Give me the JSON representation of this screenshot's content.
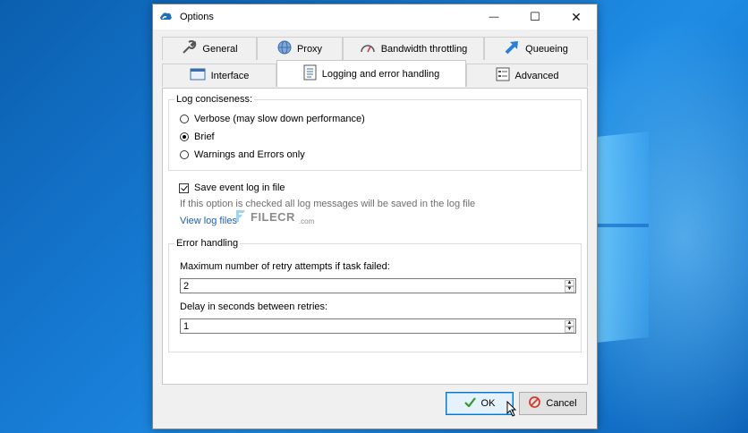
{
  "window": {
    "title": "Options"
  },
  "titlebar": {
    "minimize": "—",
    "maximize": "☐",
    "close": "✕"
  },
  "tabs": {
    "row1": [
      {
        "label": "General",
        "icon": "wrench-icon"
      },
      {
        "label": "Proxy",
        "icon": "globe-icon"
      },
      {
        "label": "Bandwidth throttling",
        "icon": "gauge-icon"
      },
      {
        "label": "Queueing",
        "icon": "arrow-up-right-icon"
      }
    ],
    "row2": [
      {
        "label": "Interface",
        "icon": "window-icon"
      },
      {
        "label": "Logging and error handling",
        "icon": "document-icon",
        "active": true
      },
      {
        "label": "Advanced",
        "icon": "list-settings-icon"
      }
    ]
  },
  "log_conciseness": {
    "legend": "Log conciseness:",
    "options": [
      {
        "label": "Verbose (may slow down performance)",
        "selected": false
      },
      {
        "label": "Brief",
        "selected": true
      },
      {
        "label": "Warnings and Errors only",
        "selected": false
      }
    ]
  },
  "event_log": {
    "checkbox_label": "Save event log in file",
    "checked": true,
    "hint": "If this option is checked all log messages will be saved in the log file",
    "link": "View log files"
  },
  "watermark": {
    "text": "FILECR",
    "sub": ".com"
  },
  "error_handling": {
    "legend": "Error handling",
    "retry_label": "Maximum number of retry attempts if task failed:",
    "retry_value": "2",
    "delay_label": "Delay in seconds between retries:",
    "delay_value": "1"
  },
  "buttons": {
    "ok": "OK",
    "cancel": "Cancel"
  },
  "colors": {
    "accent": "#0078d7",
    "link": "#1e5fb4",
    "ok_icon": "#2e9e2e",
    "cancel_icon": "#d23c2c"
  }
}
